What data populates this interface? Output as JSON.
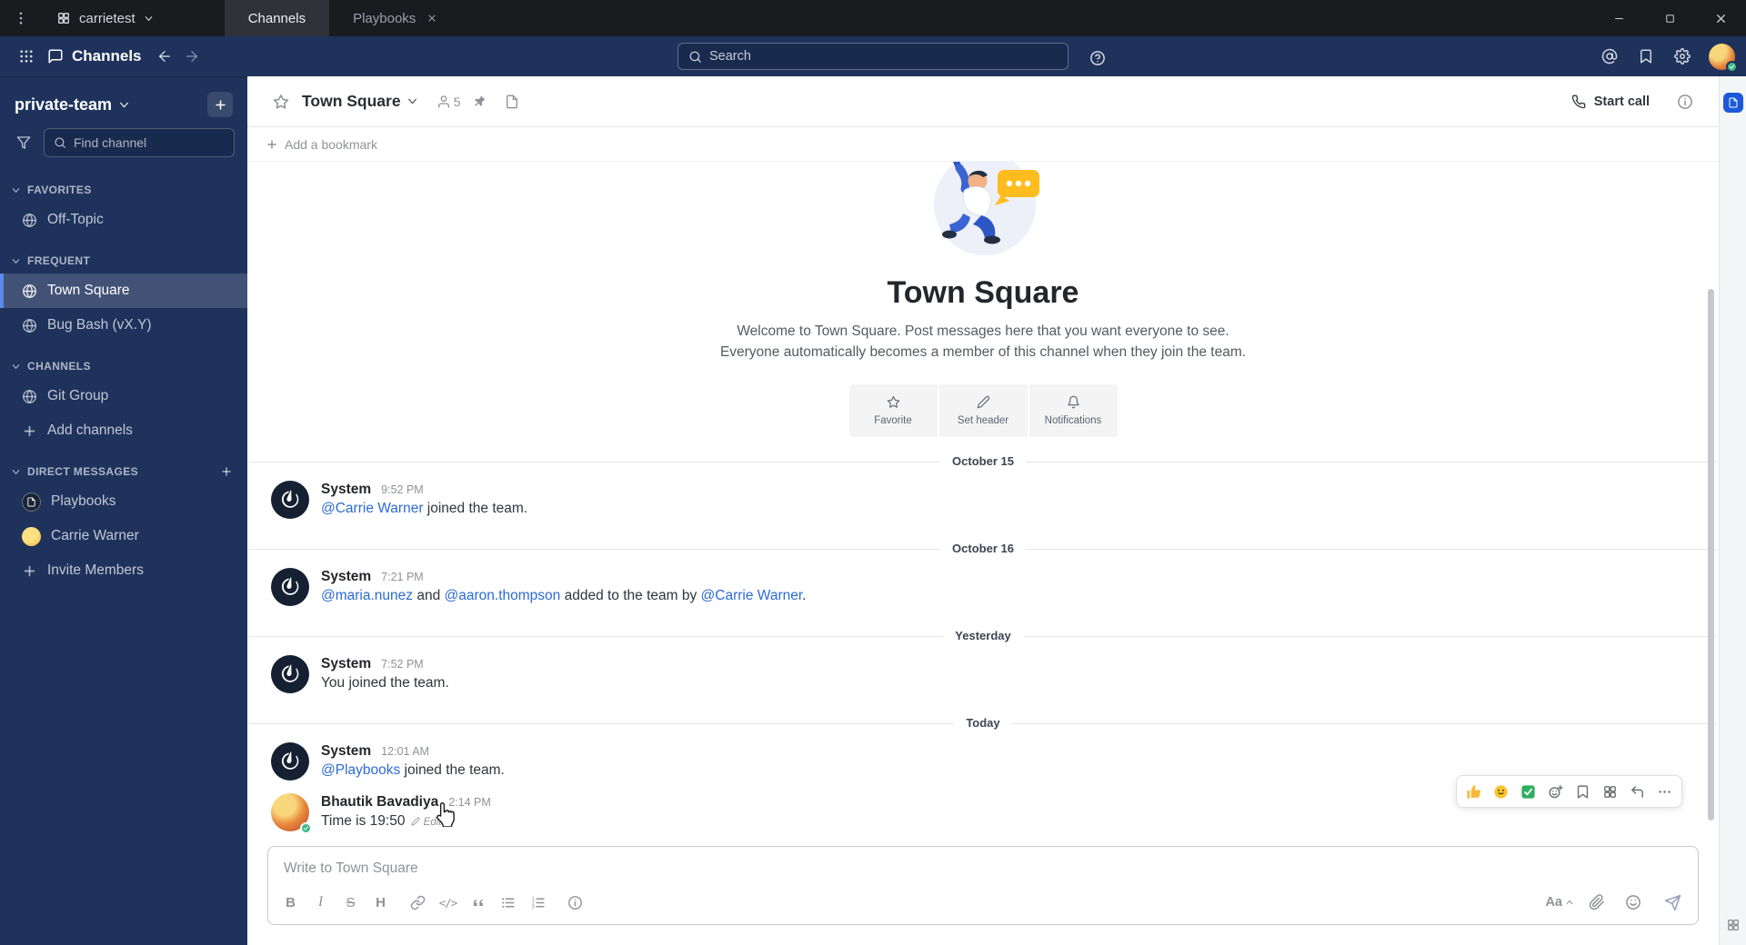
{
  "titlebar": {
    "team_switcher": "carrietest",
    "tabs": [
      {
        "label": "Channels"
      },
      {
        "label": "Playbooks"
      }
    ]
  },
  "header": {
    "product_name": "Channels",
    "search_placeholder": "Search"
  },
  "sidebar": {
    "team_name": "private-team",
    "find_channel_placeholder": "Find channel",
    "sections": [
      {
        "label": "FAVORITES",
        "items": [
          {
            "label": "Off-Topic"
          }
        ]
      },
      {
        "label": "FREQUENT",
        "items": [
          {
            "label": "Town Square"
          },
          {
            "label": "Bug Bash (vX.Y)"
          }
        ]
      },
      {
        "label": "CHANNELS",
        "items": [
          {
            "label": "Git Group"
          },
          {
            "label": "Add channels"
          }
        ]
      },
      {
        "label": "DIRECT MESSAGES",
        "items": [
          {
            "label": "Playbooks"
          },
          {
            "label": "Carrie Warner"
          },
          {
            "label": "Invite Members"
          }
        ]
      }
    ]
  },
  "channel_header": {
    "title": "Town Square",
    "member_count": "5",
    "start_call_label": "Start call"
  },
  "bookmark_bar": {
    "add_label": "Add a bookmark"
  },
  "intro": {
    "title": "Town Square",
    "description": "Welcome to Town Square. Post messages here that you want everyone to see. Everyone automatically becomes a member of this channel when they join the team.",
    "actions": [
      {
        "label": "Favorite"
      },
      {
        "label": "Set header"
      },
      {
        "label": "Notifications"
      }
    ]
  },
  "messages": [
    {
      "kind": "divider",
      "label": "October 15"
    },
    {
      "kind": "post",
      "sender": "System",
      "time": "9:52 PM",
      "seg": [
        {
          "t": "@Carrie Warner"
        },
        {
          "t": " joined the team."
        }
      ]
    },
    {
      "kind": "divider",
      "label": "October 16"
    },
    {
      "kind": "post",
      "sender": "System",
      "time": "7:21 PM",
      "seg": [
        {
          "t": "@maria.nunez"
        },
        {
          "t": " and "
        },
        {
          "t": "@aaron.thompson"
        },
        {
          "t": " added to the team by "
        },
        {
          "t": "@Carrie Warner"
        },
        {
          "t": "."
        }
      ]
    },
    {
      "kind": "divider",
      "label": "Yesterday"
    },
    {
      "kind": "post",
      "sender": "System",
      "time": "7:52 PM",
      "seg": [
        {
          "t": "You joined the team."
        }
      ]
    },
    {
      "kind": "divider",
      "label": "Today"
    },
    {
      "kind": "post",
      "sender": "System",
      "time": "12:01 AM",
      "seg": [
        {
          "t": "@Playbooks"
        },
        {
          "t": " joined the team."
        }
      ]
    },
    {
      "kind": "post",
      "sender": "Bhautik Bavadiya",
      "time": "2:14 PM",
      "seg": [
        {
          "t": "Time is 19:50"
        }
      ],
      "edited_label": "Edited"
    }
  ],
  "composer": {
    "placeholder": "Write to Town Square",
    "icons": {
      "bold": "B",
      "italic": "I",
      "strike": "S",
      "heading": "H",
      "code": "</>"
    },
    "aa_label": "Aa"
  },
  "colors": {
    "sidebar_bg": "#1e325c",
    "titlebar_bg": "#191b1f",
    "accent_blue": "#1c58d9",
    "link_blue": "#2b6bd4",
    "selected_border": "#5d89ea",
    "online_green": "#3db887"
  }
}
